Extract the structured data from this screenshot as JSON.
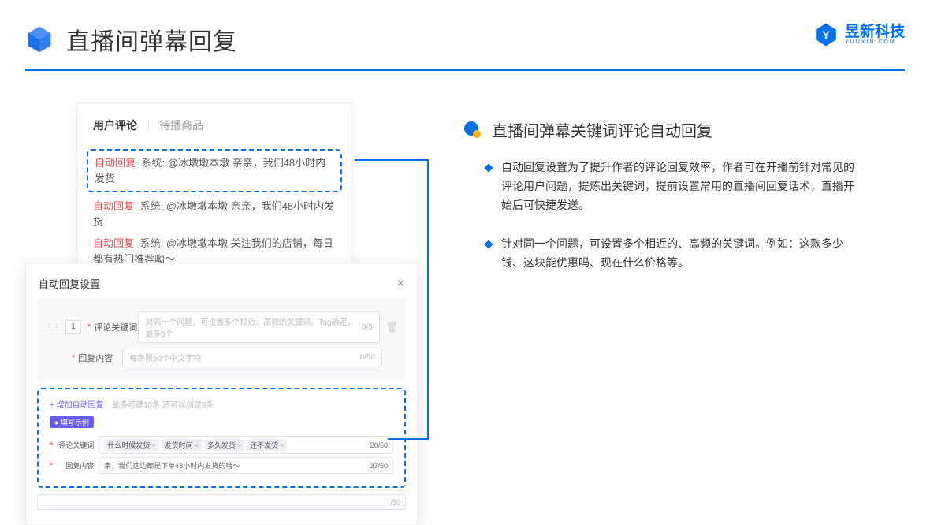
{
  "page_title": "直播间弹幕回复",
  "brand": {
    "name": "昱新科技",
    "sub": "YUUXIN.COM"
  },
  "comments_card": {
    "tabs": [
      "用户评论",
      "待播商品"
    ],
    "rows": [
      {
        "tag": "自动回复",
        "sys": "系统:",
        "text": "@冰墩墩本墩 亲亲，我们48小时内发货",
        "highlight": true
      },
      {
        "tag": "自动回复",
        "sys": "系统:",
        "text": "@冰墩墩本墩 亲亲，我们48小时内发货",
        "highlight": false
      },
      {
        "tag": "自动回复",
        "sys": "系统:",
        "text": "@冰墩墩本墩 关注我们的店铺，每日都有热门推荐呦～",
        "highlight": false
      }
    ]
  },
  "settings": {
    "title": "自动回复设置",
    "num": "1",
    "rows": [
      {
        "label": "评论关键词",
        "placeholder": "对同一个问题，可设置多个相近、高频的关键词。Tag确定，最多5个",
        "count": "0/5"
      },
      {
        "label": "回复内容",
        "placeholder": "每条限50个中文字符",
        "count": "0/50"
      }
    ],
    "add_link": "+ 增加自动回复",
    "add_hint": "最多可建10条 还可以创建9条",
    "badge": "● 填写示例",
    "ex_rows": [
      {
        "label": "评论关键词",
        "chips": [
          "什么时候发货",
          "发货时间",
          "多久发货",
          "还不发货"
        ],
        "count": "20/50"
      },
      {
        "label": "回复内容",
        "text": "亲，我们这边都是下单48小时内发货的哦～",
        "count": "37/50"
      }
    ],
    "ghost_count": "/50"
  },
  "right": {
    "section_title": "直播间弹幕关键词评论自动回复",
    "bullets": [
      "自动回复设置为了提升作者的评论回复效率，作者可在开播前针对常见的评论用户问题，提炼出关键词，提前设置常用的直播间回复话术，直播开始后可快捷发送。",
      "针对同一个问题，可设置多个相近的、高频的关键词。例如：这款多少钱、这块能优惠吗、现在什么价格等。"
    ]
  }
}
